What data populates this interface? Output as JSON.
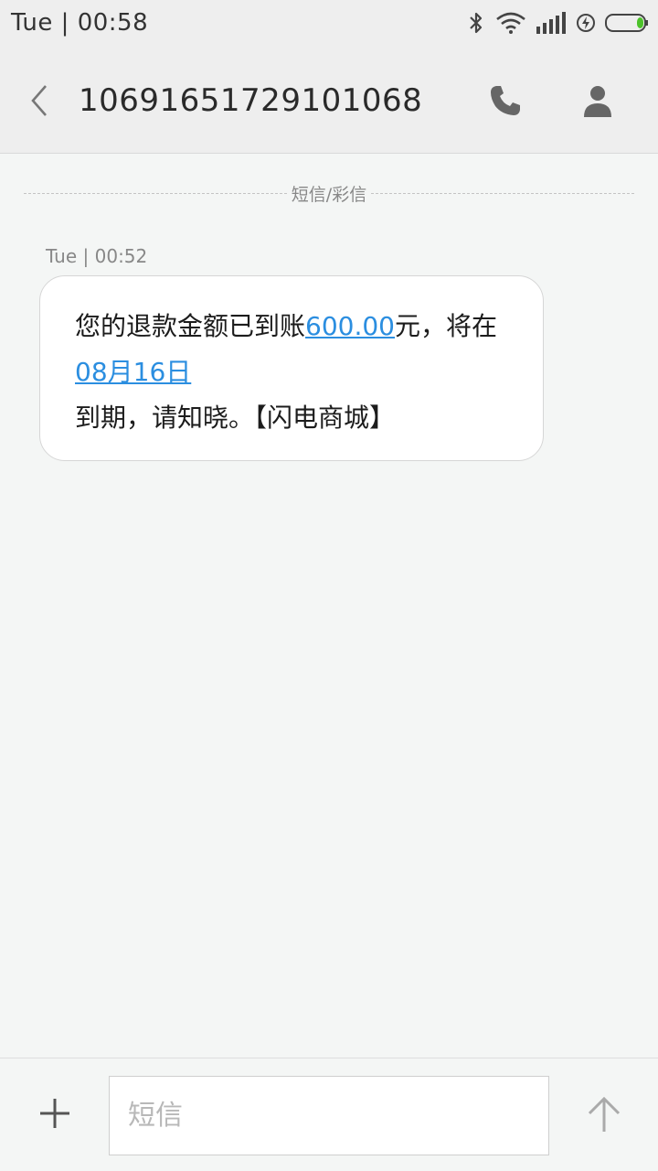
{
  "status_bar": {
    "time": "Tue | 00:58"
  },
  "header": {
    "title": "10691651729101068",
    "back_icon": "chevron-left-icon",
    "call_icon": "phone-icon",
    "contact_icon": "person-icon"
  },
  "conversation": {
    "channel_label": "短信/彩信",
    "messages": [
      {
        "time": "Tue | 00:52",
        "parts": {
          "p1": "您的退款金额已到账",
          "amount": "600.00",
          "p2": "元，将在",
          "date": "08月16日",
          "p3": "到期，请知晓。【闪电商城】"
        }
      }
    ]
  },
  "composer": {
    "placeholder": "短信",
    "value": "",
    "attach_icon": "plus-icon",
    "send_icon": "arrow-up-icon"
  },
  "colors": {
    "link": "#2b8ee0",
    "background": "#f4f6f5",
    "header": "#eeeeee",
    "battery_fill": "#4cc22a"
  }
}
